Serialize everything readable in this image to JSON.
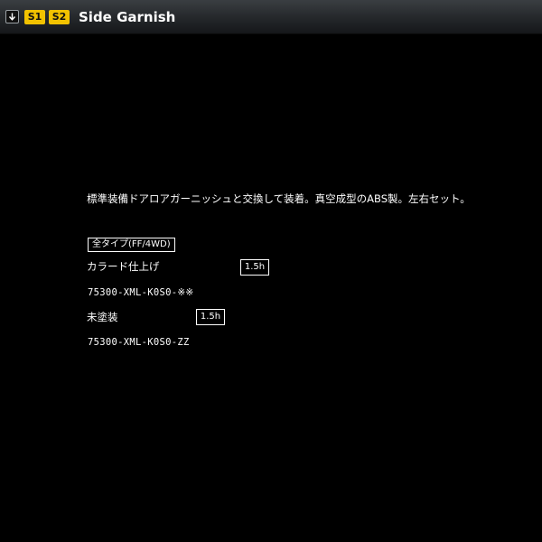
{
  "header": {
    "down_icon": "arrow-down-icon",
    "badges": [
      "S1",
      "S2"
    ],
    "title": "Side Garnish",
    "badge_color": "#f2c200"
  },
  "content": {
    "description": "標準装備ドアロアガーニッシュと交換して装着。真空成型のABS製。左右セット。",
    "type_tag": "全タイプ(FF/4WD)",
    "options": [
      {
        "label": "カラード仕上げ",
        "hours": "1.5h",
        "part_number": "75300-XML-K0S0-※※"
      },
      {
        "label": "未塗装",
        "hours": "1.5h",
        "part_number": "75300-XML-K0S0-ZZ"
      }
    ]
  }
}
